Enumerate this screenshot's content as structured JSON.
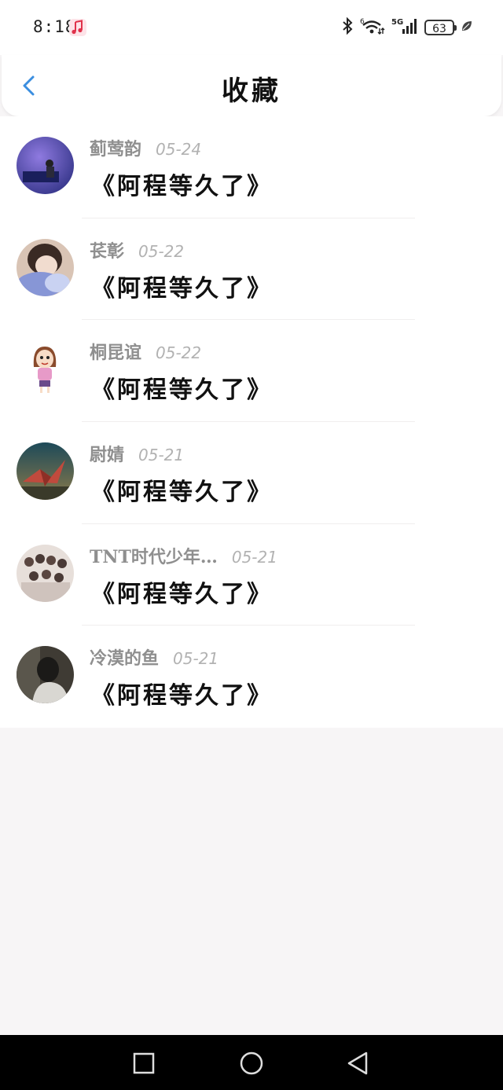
{
  "status_bar": {
    "time": "8:18",
    "battery": "63",
    "icons": [
      "music-app-icon",
      "bluetooth-icon",
      "wifi-icon",
      "5g-signal-icon",
      "battery-icon",
      "leaf-icon"
    ]
  },
  "header": {
    "title": "收藏",
    "back_icon": "chevron-left-icon"
  },
  "favorites": [
    {
      "username": "蓟莺韵",
      "date": "05-24",
      "title": "《阿程等久了》",
      "avatar_colors": [
        "#6a56c6",
        "#2b2e80"
      ]
    },
    {
      "username": "苌彰",
      "date": "05-22",
      "title": "《阿程等久了》",
      "avatar_colors": [
        "#d9c4b5",
        "#8796d6"
      ]
    },
    {
      "username": "桐昆谊",
      "date": "05-22",
      "title": "《阿程等久了》",
      "avatar_colors": [
        "#ffffff",
        "#e79ac8"
      ]
    },
    {
      "username": "尉婧",
      "date": "05-21",
      "title": "《阿程等久了》",
      "avatar_colors": [
        "#1d4a59",
        "#c04a3d"
      ]
    },
    {
      "username": "TNT时代少年…",
      "date": "05-21",
      "title": "《阿程等久了》",
      "avatar_colors": [
        "#e7dfda",
        "#b9a9a2"
      ]
    },
    {
      "username": "冷漠的鱼",
      "date": "05-21",
      "title": "《阿程等久了》",
      "avatar_colors": [
        "#3f3b34",
        "#d9d7d2"
      ]
    }
  ],
  "nav_bar": {
    "buttons": [
      "recent-apps-icon",
      "home-icon",
      "back-icon"
    ]
  },
  "colors": {
    "accent": "#3b8ee0",
    "page_bg": "#f7f5f6",
    "card_bg": "#ffffff",
    "username": "#8f8f8f",
    "date": "#b2b2b2",
    "title": "#111111"
  }
}
